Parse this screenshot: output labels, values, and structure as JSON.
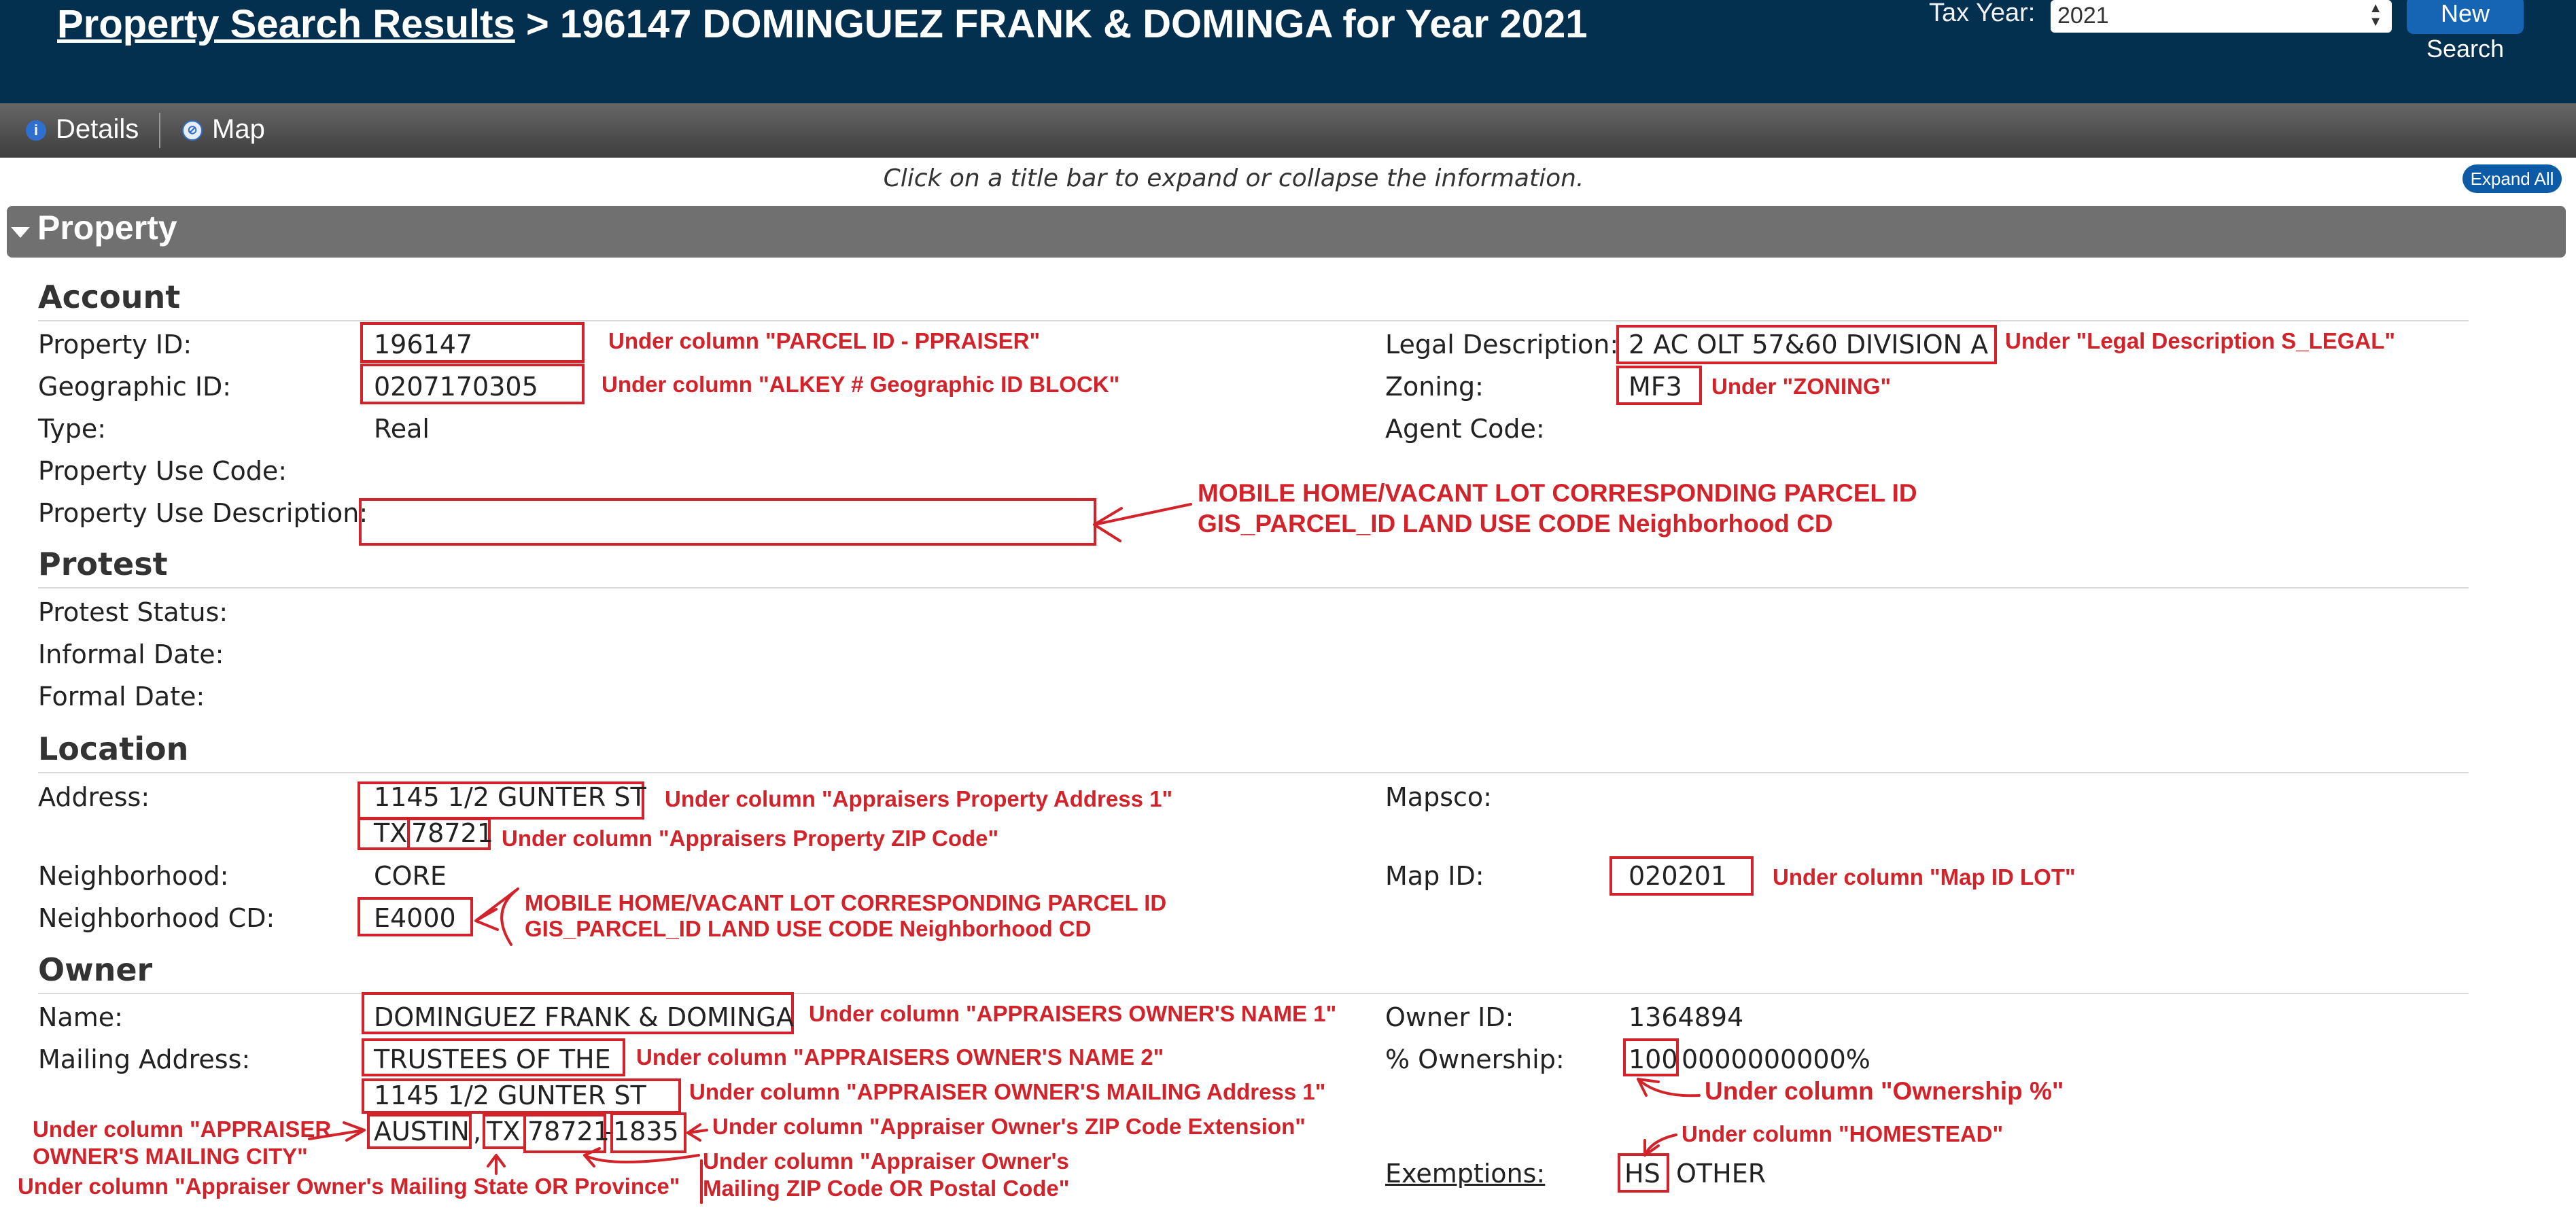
{
  "header": {
    "breadcrumb_link": "Property Search Results",
    "breadcrumb_rest": " > 196147 DOMINGUEZ FRANK & DOMINGA for Year 2021",
    "tax_year_label": "Tax Year:",
    "tax_year_value": "2021",
    "new_search_label": "New Search"
  },
  "toolbar": {
    "details_label": "Details",
    "map_label": "Map"
  },
  "hint": "Click on a title bar to expand or collapse the information.",
  "expand_all_label": "Expand All",
  "property_section_title": "Property",
  "account": {
    "title": "Account",
    "property_id_label": "Property ID:",
    "property_id": "196147",
    "geographic_id_label": "Geographic ID:",
    "geographic_id": "0207170305",
    "type_label": "Type:",
    "type": "Real",
    "property_use_code_label": "Property Use Code:",
    "property_use_description_label": "Property Use Description:",
    "legal_description_label": "Legal Description:",
    "legal_description": "2 AC OLT 57&60 DIVISION A",
    "zoning_label": "Zoning:",
    "zoning": "MF3",
    "agent_code_label": "Agent Code:"
  },
  "protest": {
    "title": "Protest",
    "status_label": "Protest Status:",
    "informal_label": "Informal Date:",
    "formal_label": "Formal Date:"
  },
  "location": {
    "title": "Location",
    "address_label": "Address:",
    "address_line1": "1145 1/2 GUNTER ST",
    "address_state": "TX",
    "address_zip": "78721",
    "neighborhood_label": "Neighborhood:",
    "neighborhood": "CORE",
    "neighborhood_cd_label": "Neighborhood CD:",
    "neighborhood_cd": "E4000",
    "mapsco_label": "Mapsco:",
    "map_id_label": "Map ID:",
    "map_id": "020201"
  },
  "owner": {
    "title": "Owner",
    "name_label": "Name:",
    "name": "DOMINGUEZ FRANK & DOMINGA",
    "mailing_label": "Mailing Address:",
    "mailing_line1": "TRUSTEES OF THE",
    "mailing_line2": "1145 1/2 GUNTER ST",
    "mailing_city": "AUSTIN",
    "comma": ",",
    "mailing_state": "TX",
    "mailing_zip": "78721",
    "dash": "-",
    "mailing_zip_ext": "1835",
    "owner_id_label": "Owner ID:",
    "owner_id": "1364894",
    "ownership_label": "% Ownership:",
    "ownership_boxed": "100",
    "ownership_rest": "0000000000%",
    "exemptions_label": "Exemptions:",
    "exemption_hs": "HS",
    "exemption_other": "OTHER"
  },
  "annotations": {
    "property_id": "Under column \"PARCEL ID - PPRAISER\"",
    "geographic_id": "Under column \"ALKEY #   Geographic ID   BLOCK\"",
    "legal": "Under \"Legal Description    S_LEGAL\"",
    "zoning": "Under \"ZONING\"",
    "use_desc_1": "MOBILE HOME/VACANT LOT CORRESPONDING PARCEL ID",
    "use_desc_2": "GIS_PARCEL_ID     LAND USE CODE     Neighborhood CD",
    "address": "Under column \"Appraisers Property Address 1\"",
    "zip": "Under column \"Appraisers Property ZIP Code\"",
    "map_id": "Under column \"Map ID      LOT\"",
    "ncd_1": "MOBILE HOME/VACANT LOT CORRESPONDING PARCEL ID",
    "ncd_2": "GIS_PARCEL_ID LAND USE CODE  Neighborhood CD",
    "owner_name1": "Under column \"APPRAISERS OWNER'S NAME 1\"",
    "owner_name2": "Under column \"APPRAISERS OWNER'S NAME 2\"",
    "mail_addr1": "Under column \"APPRAISER OWNER'S MAILING Address 1\"",
    "city_1": "Under column \"APPRAISER",
    "city_2": "OWNER'S MAILING CITY\"",
    "zip_ext": "Under column \"Appraiser Owner's ZIP Code Extension\"",
    "state": "Under column \"Appraiser Owner's Mailing State  OR  Province\"",
    "mail_zip_1": "Under column \"Appraiser Owner's",
    "mail_zip_2": "Mailing ZIP Code OR  Postal Code\"",
    "ownership": "Under column \"Ownership   %\"",
    "homestead": "Under column \"HOMESTEAD\""
  }
}
